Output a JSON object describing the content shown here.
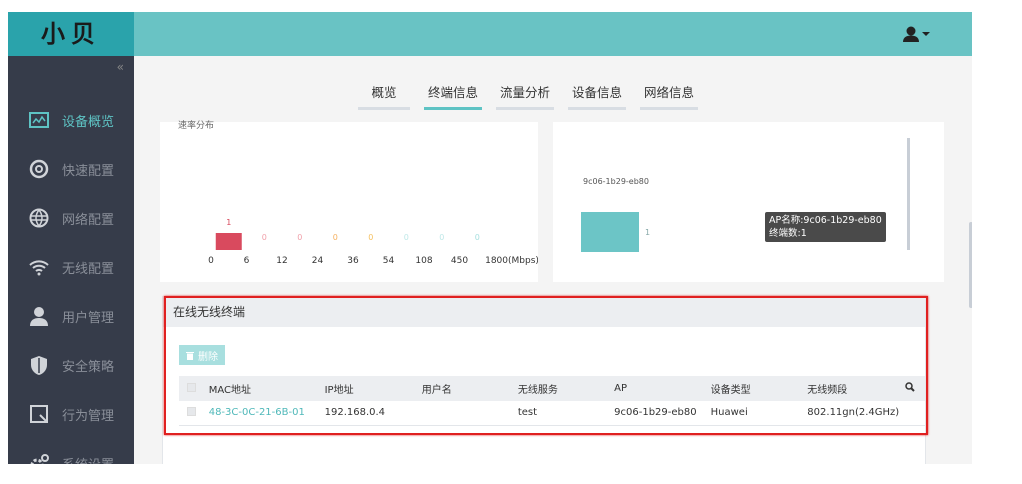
{
  "app": {
    "logo": "小贝"
  },
  "sidebar": {
    "collapse": "«",
    "items": [
      {
        "label": "设备概览",
        "icon": "chart-monitor-icon",
        "active": true
      },
      {
        "label": "快速配置",
        "icon": "quick-config-icon"
      },
      {
        "label": "网络配置",
        "icon": "globe-icon"
      },
      {
        "label": "无线配置",
        "icon": "wifi-icon"
      },
      {
        "label": "用户管理",
        "icon": "user-icon"
      },
      {
        "label": "安全策略",
        "icon": "shield-icon"
      },
      {
        "label": "行为管理",
        "icon": "behavior-icon"
      },
      {
        "label": "系统设置",
        "icon": "gear-icon"
      }
    ]
  },
  "tabs": [
    {
      "label": "概览"
    },
    {
      "label": "终端信息",
      "active": true
    },
    {
      "label": "流量分析"
    },
    {
      "label": "设备信息"
    },
    {
      "label": "网络信息"
    }
  ],
  "chart_data": [
    {
      "type": "bar",
      "title": "速率分布",
      "categories": [
        "0",
        "6",
        "12",
        "24",
        "36",
        "54",
        "108",
        "450",
        "1800(Mbps)"
      ],
      "values": [
        1,
        0,
        0,
        0,
        0,
        0,
        0,
        0
      ],
      "value_colors": [
        "#d94a5e",
        "#f0a0aa",
        "#f0a0aa",
        "#f5b060",
        "#f5c060",
        "#bfe8e8",
        "#bfe8e8",
        "#a8e0e0"
      ]
    },
    {
      "type": "bar",
      "categories": [
        "9c06-1b29-eb80"
      ],
      "values": [
        1
      ],
      "color": "#6cc5c6",
      "tooltip": {
        "line1": "AP名称:9c06-1b29-eb80",
        "line2": "终端数:1"
      }
    }
  ],
  "panel": {
    "title": "在线无线终端",
    "delete_label": "删除",
    "columns": [
      "MAC地址",
      "IP地址",
      "用户名",
      "无线服务",
      "AP",
      "设备类型",
      "无线频段"
    ],
    "rows": [
      {
        "mac": "48-3C-0C-21-6B-01",
        "ip": "192.168.0.4",
        "user": "",
        "ssid": "test",
        "ap": "9c06-1b29-eb80",
        "type": "Huawei",
        "band": "802.11gn(2.4GHz)"
      }
    ]
  }
}
